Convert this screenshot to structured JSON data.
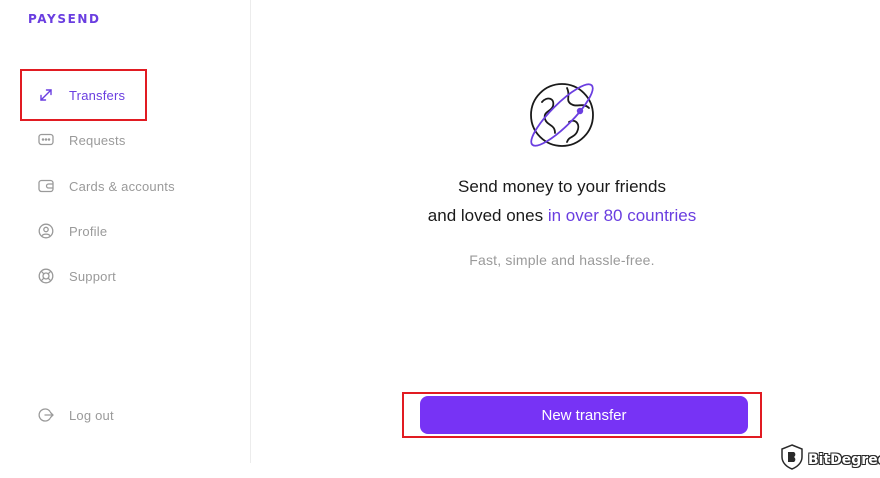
{
  "brand": {
    "logo_text": "PAYSEND"
  },
  "sidebar": {
    "items": [
      {
        "label": "Transfers",
        "icon": "arrows-expand-icon",
        "active": true
      },
      {
        "label": "Requests",
        "icon": "chat-bubble-icon",
        "active": false
      },
      {
        "label": "Cards & accounts",
        "icon": "wallet-icon",
        "active": false
      },
      {
        "label": "Profile",
        "icon": "user-circle-icon",
        "active": false
      },
      {
        "label": "Support",
        "icon": "lifebuoy-icon",
        "active": false
      }
    ],
    "logout_label": "Log out"
  },
  "main": {
    "illustration_icon": "globe-orbit-icon",
    "headline_line1": "Send money to your friends",
    "headline_line2_prefix": "and loved ones ",
    "headline_line2_accent": "in over 80 countries",
    "subline": "Fast, simple and hassle-free.",
    "cta_label": "New transfer"
  },
  "watermark": {
    "text": "BitDegree"
  },
  "colors": {
    "accent": "#6a3ee0",
    "button": "#7733f5",
    "muted": "#9a9a9a",
    "highlight": "#e11b22"
  }
}
